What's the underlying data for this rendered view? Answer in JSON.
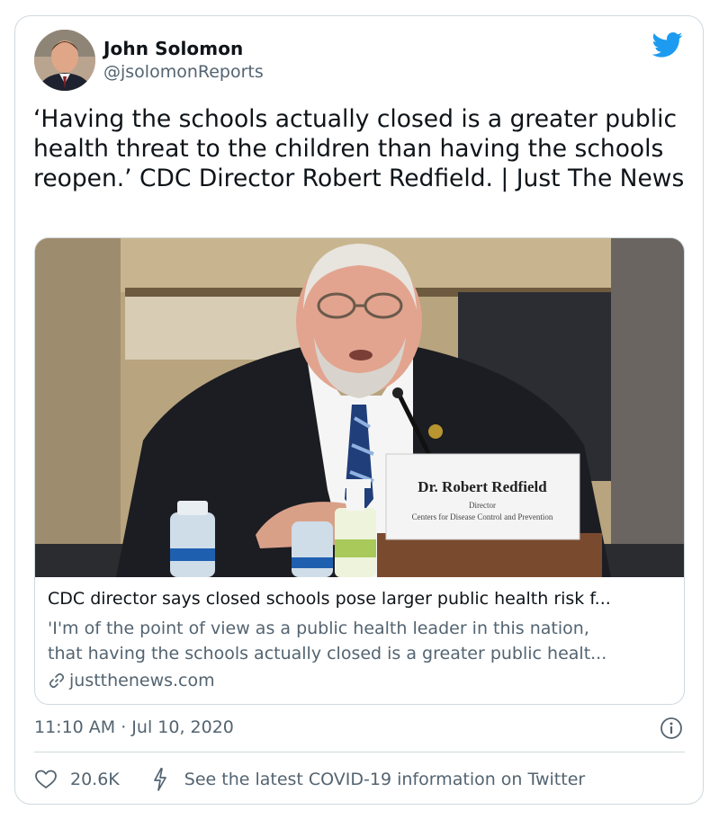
{
  "author": {
    "name": "John Solomon",
    "handle": "@jsolomonReports"
  },
  "tweet": {
    "text": "‘Having the schools actually closed is a greater public health threat to the children than having the schools reopen.’ CDC Director Robert Redfield. | Just The News"
  },
  "link_card": {
    "image_placard": {
      "name": "Dr. Robert Redfield",
      "title": "Director",
      "org": "Centers for Disease Control and Prevention"
    },
    "title": "CDC director says closed schools pose larger public health risk f...",
    "description_line1": "'I'm of the point of view as a public health leader in this nation,",
    "description_line2": "that having the schools actually closed is a greater public healt...",
    "domain": "justthenews.com"
  },
  "meta": {
    "timestamp": "11:10 AM · Jul 10, 2020"
  },
  "actions": {
    "like_count": "20.6K",
    "covid_info": "See the latest COVID-19 information on Twitter"
  },
  "colors": {
    "twitter_blue": "#1d9bf0",
    "text_primary": "#0f1419",
    "text_secondary": "#536471",
    "border": "#cfd9de"
  },
  "icons": [
    "twitter-bird-icon",
    "info-icon",
    "heart-icon",
    "lightning-icon",
    "link-icon"
  ]
}
